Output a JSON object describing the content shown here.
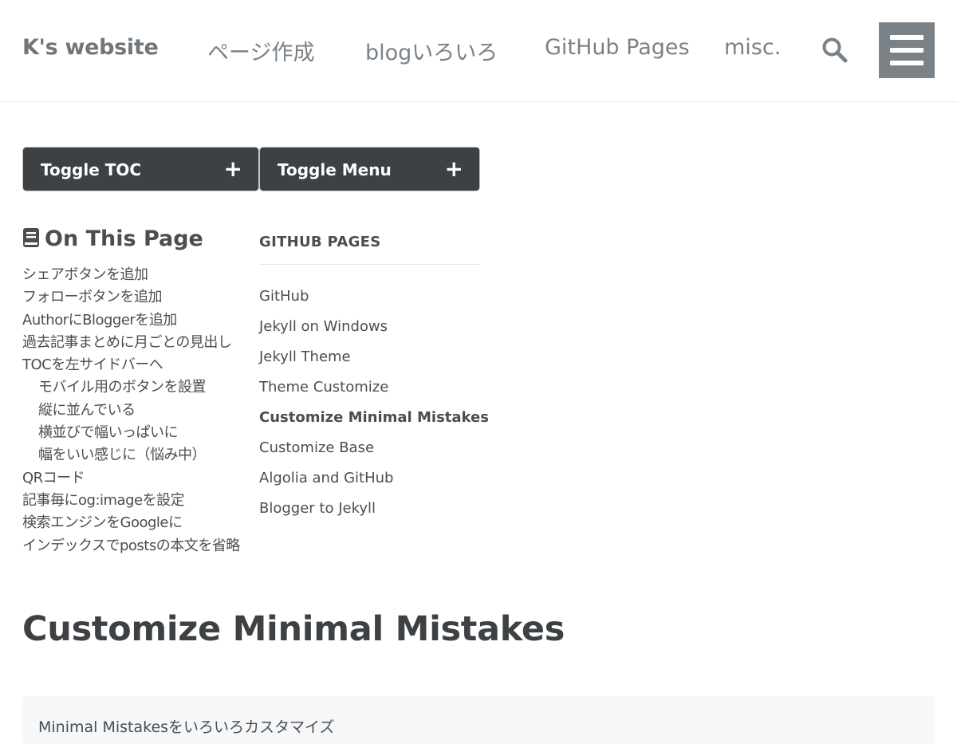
{
  "masthead": {
    "site_title": "K's website",
    "nav": [
      {
        "label": "ページ作成"
      },
      {
        "label": "blogいろいろ"
      },
      {
        "label": "GitHub Pages"
      },
      {
        "label": "misc."
      }
    ],
    "search_icon": "search-icon",
    "menu_icon": "hamburger-icon"
  },
  "toggles": {
    "toc_label": "Toggle TOC",
    "menu_label": "Toggle Menu",
    "plus": "+"
  },
  "toc": {
    "title": "On This Page",
    "icon": "book-icon",
    "items": [
      {
        "label": "シェアボタンを追加",
        "level": 1
      },
      {
        "label": "フォローボタンを追加",
        "level": 1
      },
      {
        "label": "AuthorにBloggerを追加",
        "level": 1
      },
      {
        "label": "過去記事まとめに月ごとの見出し",
        "level": 1
      },
      {
        "label": "TOCを左サイドバーへ",
        "level": 1
      },
      {
        "label": "モバイル用のボタンを設置",
        "level": 2
      },
      {
        "label": "縦に並んでいる",
        "level": 2
      },
      {
        "label": "横並びで幅いっぱいに",
        "level": 2
      },
      {
        "label": "幅をいい感じに（悩み中）",
        "level": 2
      },
      {
        "label": "QRコード",
        "level": 1
      },
      {
        "label": "記事毎にog:imageを設定",
        "level": 1
      },
      {
        "label": "検索エンジンをGoogleに",
        "level": 1
      },
      {
        "label": "インデックスでpostsの本文を省略",
        "level": 1
      }
    ]
  },
  "sidebar_nav": {
    "title": "GITHUB PAGES",
    "items": [
      {
        "label": "GitHub"
      },
      {
        "label": "Jekyll on Windows"
      },
      {
        "label": "Jekyll Theme"
      },
      {
        "label": "Theme Customize"
      },
      {
        "label": "Customize Minimal Mistakes",
        "active": true
      },
      {
        "label": "Customize Base"
      },
      {
        "label": "Algolia and GitHub"
      },
      {
        "label": "Blogger to Jekyll"
      }
    ]
  },
  "main": {
    "title": "Customize Minimal Mistakes",
    "excerpt": "Minimal Mistakesをいろいろカスタマイズ"
  },
  "colors": {
    "button_bg": "#3d4144",
    "hamburger_bg": "#7a8288",
    "text": "#494e52"
  }
}
